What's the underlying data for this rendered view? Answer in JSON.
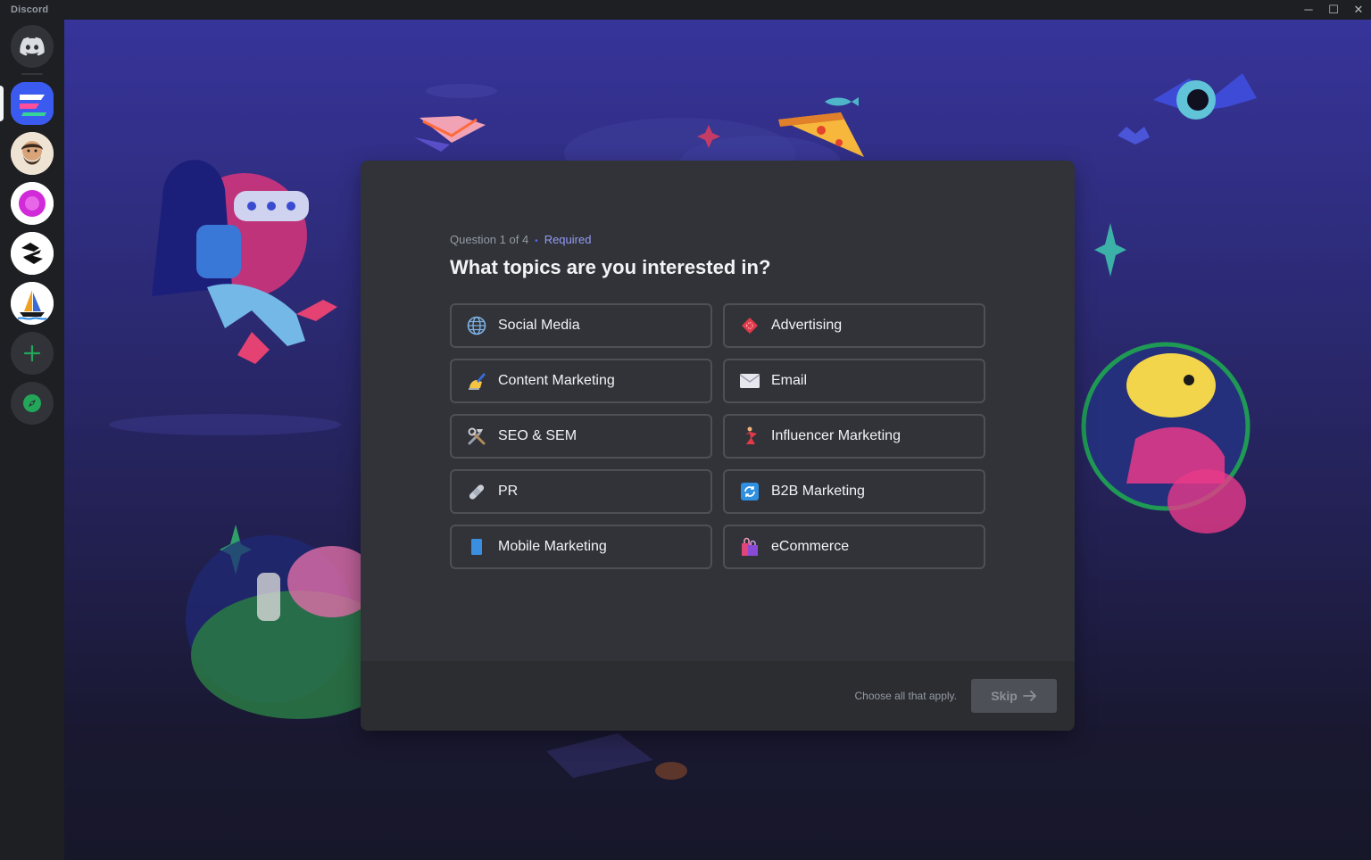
{
  "window": {
    "app_title": "Discord",
    "minimize": "─",
    "maximize": "☐",
    "close": "✕"
  },
  "guilds": [
    {
      "name": "home",
      "icon": "discord-logo-icon"
    },
    {
      "name": "server-1",
      "icon": "stripes-logo-icon"
    },
    {
      "name": "server-2",
      "icon": "bearded-avatar-icon"
    },
    {
      "name": "server-3",
      "icon": "pink-circle-icon"
    },
    {
      "name": "server-4",
      "icon": "swirl-logo-icon"
    },
    {
      "name": "server-5",
      "icon": "sailboat-icon"
    },
    {
      "name": "add-server",
      "icon": "plus-icon"
    },
    {
      "name": "explore",
      "icon": "compass-icon"
    }
  ],
  "dialog": {
    "question_counter": "Question 1 of 4",
    "required_label": "Required",
    "title": "What topics are you interested in?",
    "options": [
      {
        "label": "Social Media",
        "icon": "globe-icon"
      },
      {
        "label": "Advertising",
        "icon": "ticket-icon"
      },
      {
        "label": "Content Marketing",
        "icon": "writing-hand-icon"
      },
      {
        "label": "Email",
        "icon": "envelope-icon"
      },
      {
        "label": "SEO & SEM",
        "icon": "hammer-wrench-icon"
      },
      {
        "label": "Influencer Marketing",
        "icon": "dancer-icon"
      },
      {
        "label": "PR",
        "icon": "bandage-icon"
      },
      {
        "label": "B2B Marketing",
        "icon": "arrows-cycle-icon"
      },
      {
        "label": "Mobile Marketing",
        "icon": "phone-icon"
      },
      {
        "label": "eCommerce",
        "icon": "shopping-bags-icon"
      }
    ],
    "footer_hint": "Choose all that apply.",
    "skip_label": "Skip"
  },
  "colors": {
    "accent": "#5865f2",
    "required": "#949cf7",
    "dialog_bg": "#313338",
    "footer_bg": "#2b2d31",
    "option_border": "#4e5058",
    "rail_bg": "#1e1f22"
  }
}
